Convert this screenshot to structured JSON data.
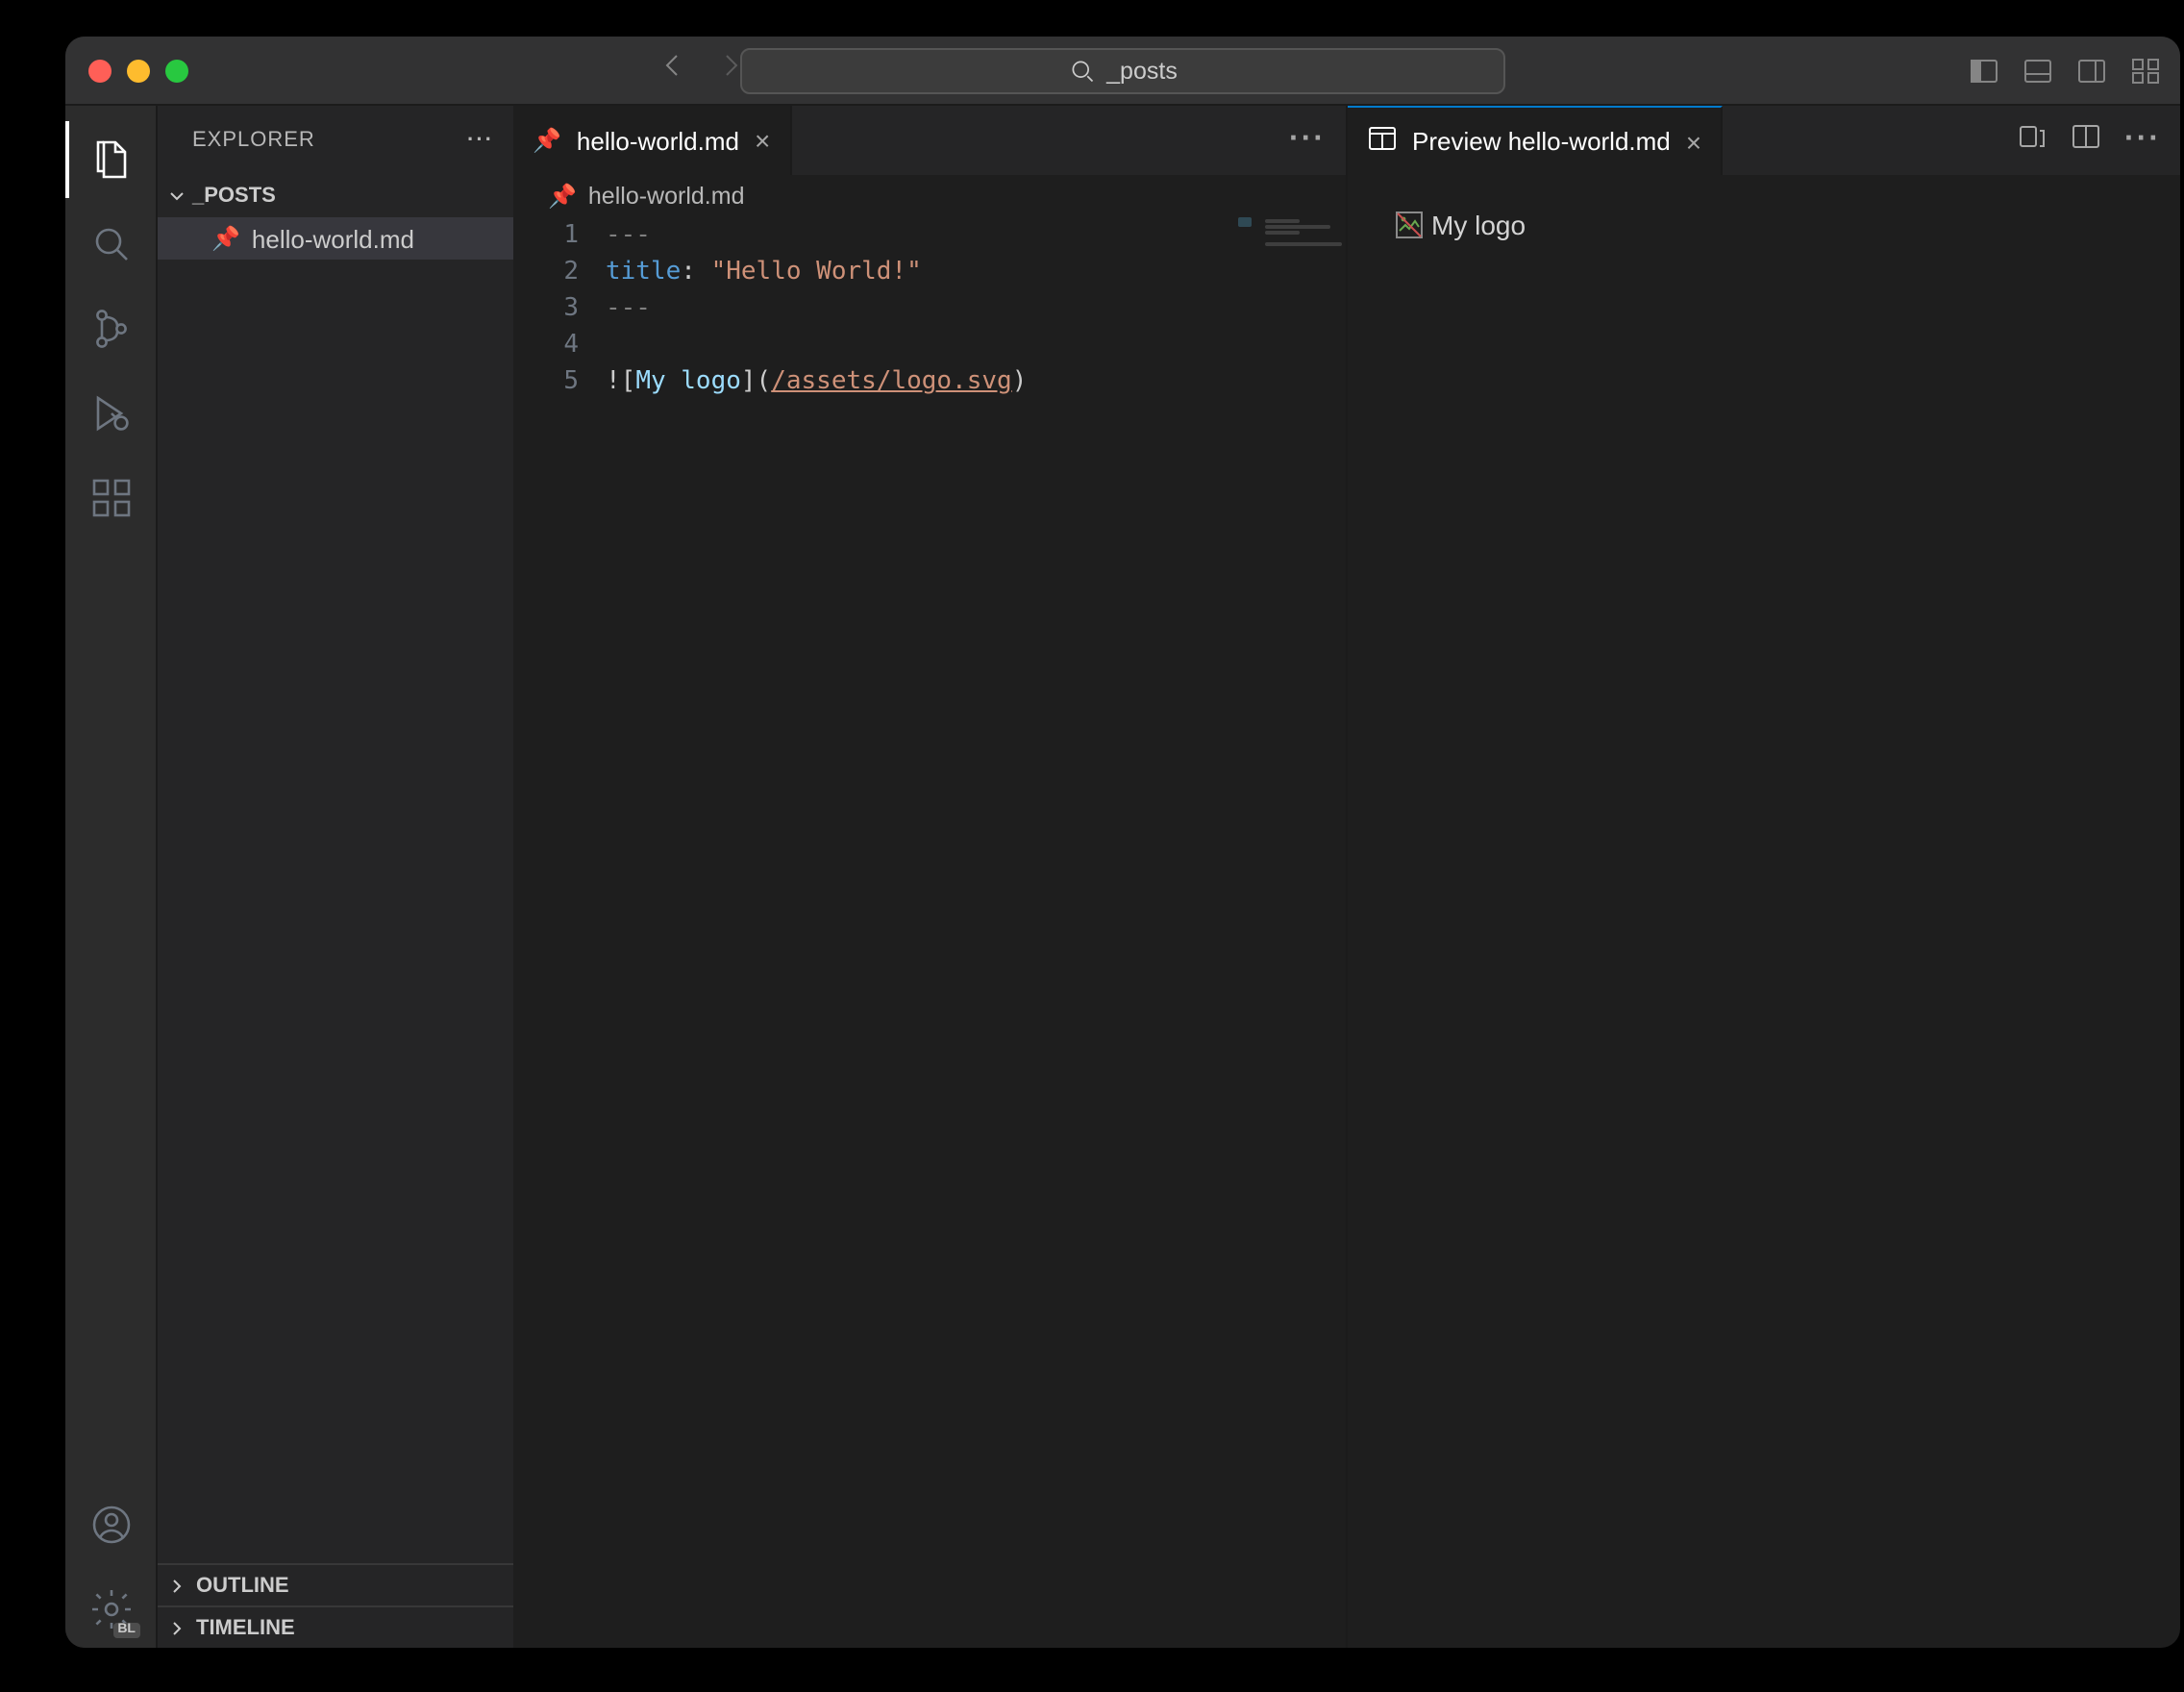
{
  "titlebar": {
    "search_text": "_posts"
  },
  "sidebar": {
    "explorer_label": "EXPLORER",
    "folder_label": "_POSTS",
    "files": [
      "hello-world.md"
    ],
    "outline_label": "OUTLINE",
    "timeline_label": "TIMELINE"
  },
  "activitybar": {
    "settings_badge": "BL"
  },
  "editor_left": {
    "tab_label": "hello-world.md",
    "breadcrumb": "hello-world.md",
    "lines": [
      {
        "n": "1",
        "segments": [
          {
            "cls": "tk-fm",
            "t": "---"
          }
        ]
      },
      {
        "n": "2",
        "segments": [
          {
            "cls": "tk-key",
            "t": "title"
          },
          {
            "cls": "tk-punc",
            "t": ": "
          },
          {
            "cls": "tk-str",
            "t": "\"Hello World!\""
          }
        ]
      },
      {
        "n": "3",
        "segments": [
          {
            "cls": "tk-fm",
            "t": "---"
          }
        ]
      },
      {
        "n": "4",
        "segments": []
      },
      {
        "n": "5",
        "segments": [
          {
            "cls": "tk-punc",
            "t": "!["
          },
          {
            "cls": "tk-id",
            "t": "My logo"
          },
          {
            "cls": "tk-punc",
            "t": "]("
          },
          {
            "cls": "tk-link",
            "t": "/assets/logo.svg"
          },
          {
            "cls": "tk-punc",
            "t": ")"
          }
        ]
      }
    ]
  },
  "editor_right": {
    "tab_label": "Preview hello-world.md",
    "preview_alt": "My logo"
  }
}
